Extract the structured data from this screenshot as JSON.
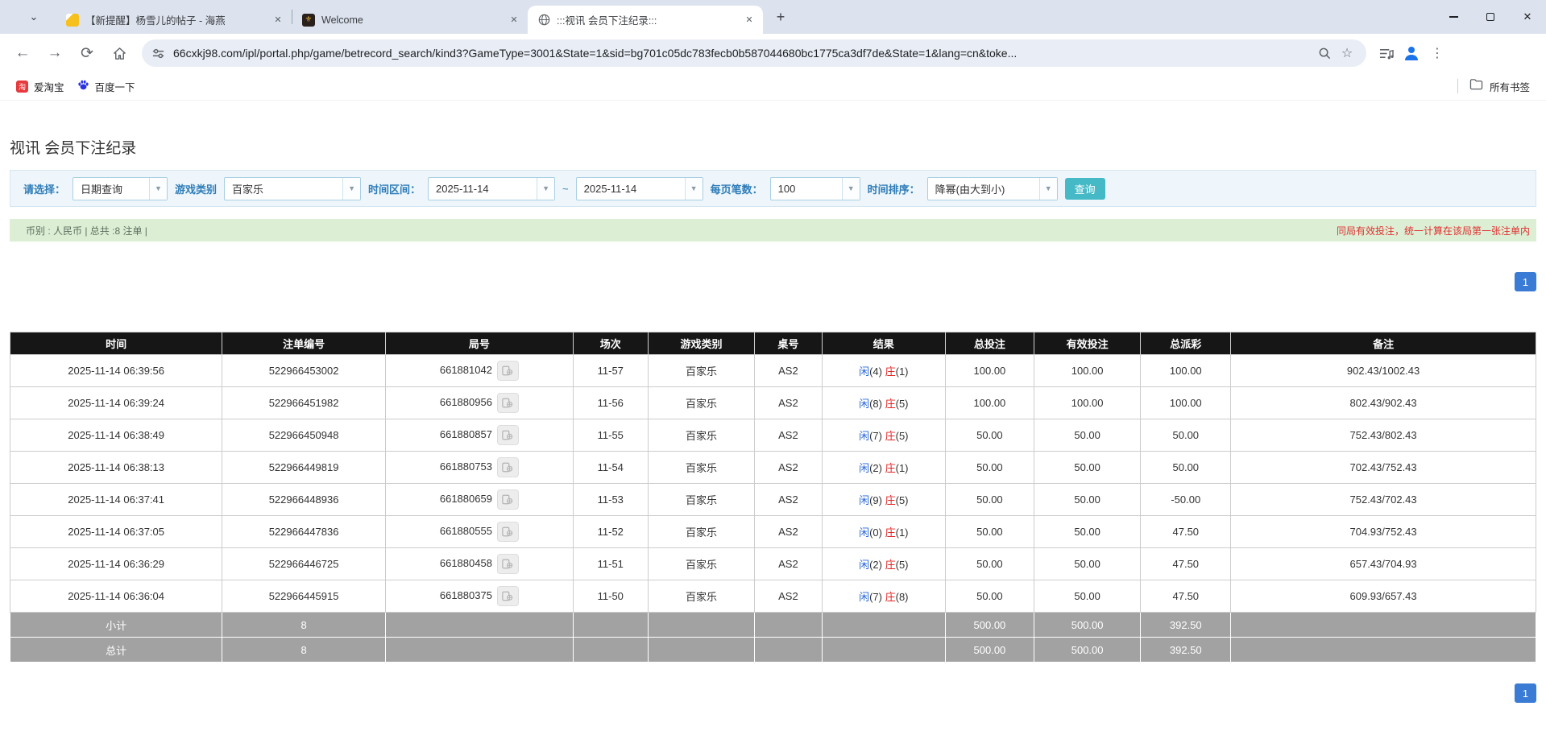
{
  "browser": {
    "tab_search_icon": "⌄",
    "tabs": [
      {
        "title": "【新提醒】杨雪儿的帖子 - 海燕",
        "close": "✕"
      },
      {
        "title": "Welcome",
        "close": "✕"
      },
      {
        "title": ":::视讯 会员下注纪录:::",
        "close": "✕"
      }
    ],
    "new_tab": "+",
    "window": {
      "close": "✕"
    },
    "url": "66cxkj98.com/ipl/portal.php/game/betrecord_search/kind3?GameType=3001&State=1&sid=bg701c05dc783fecb0b587044680bc1775ca3df7de&State=1&lang=cn&toke...",
    "bookmarks": [
      {
        "label": "爱淘宝",
        "icon_glyph": "淘"
      },
      {
        "label": "百度一下"
      }
    ],
    "all_bookmarks_label": "所有书签",
    "menu_dots": "⋮"
  },
  "page": {
    "title": "视讯 会员下注纪录",
    "filters": {
      "select_label": "请选择：",
      "select_value": "日期查询",
      "game_type_label": "游戏类别",
      "game_type_value": "百家乐",
      "date_range_label": "时间区间：",
      "date_from": "2025-11-14",
      "tilde": "~",
      "date_to": "2025-11-14",
      "per_page_label": "每页笔数：",
      "per_page_value": "100",
      "sort_label": "时间排序：",
      "sort_value": "降幂(由大到小)",
      "search_button": "查询",
      "dropdown_arrow": "▼"
    },
    "info_bar": {
      "left": "币别 : 人民币 | 总共 :8 注单 |",
      "right": "同局有效投注，统一计算在该局第一张注单内"
    },
    "pagination": {
      "page": "1"
    },
    "table": {
      "columns": [
        "时间",
        "注单编号",
        "局号",
        "场次",
        "游戏类别",
        "桌号",
        "结果",
        "总投注",
        "有效投注",
        "总派彩",
        "备注"
      ],
      "rows": [
        {
          "time": "2025-11-14 06:39:56",
          "bet_id": "522966453002",
          "round_id": "661881042",
          "session": "11-57",
          "game": "百家乐",
          "table_no": "AS2",
          "xian": "闲",
          "xian_n": "(4)",
          "zhuang": "庄",
          "zhuang_n": "(1)",
          "total_bet": "100.00",
          "valid_bet": "100.00",
          "payout": "100.00",
          "remark": "902.43/1002.43"
        },
        {
          "time": "2025-11-14 06:39:24",
          "bet_id": "522966451982",
          "round_id": "661880956",
          "session": "11-56",
          "game": "百家乐",
          "table_no": "AS2",
          "xian": "闲",
          "xian_n": "(8)",
          "zhuang": "庄",
          "zhuang_n": "(5)",
          "total_bet": "100.00",
          "valid_bet": "100.00",
          "payout": "100.00",
          "remark": "802.43/902.43"
        },
        {
          "time": "2025-11-14 06:38:49",
          "bet_id": "522966450948",
          "round_id": "661880857",
          "session": "11-55",
          "game": "百家乐",
          "table_no": "AS2",
          "xian": "闲",
          "xian_n": "(7)",
          "zhuang": "庄",
          "zhuang_n": "(5)",
          "total_bet": "50.00",
          "valid_bet": "50.00",
          "payout": "50.00",
          "remark": "752.43/802.43"
        },
        {
          "time": "2025-11-14 06:38:13",
          "bet_id": "522966449819",
          "round_id": "661880753",
          "session": "11-54",
          "game": "百家乐",
          "table_no": "AS2",
          "xian": "闲",
          "xian_n": "(2)",
          "zhuang": "庄",
          "zhuang_n": "(1)",
          "total_bet": "50.00",
          "valid_bet": "50.00",
          "payout": "50.00",
          "remark": "702.43/752.43"
        },
        {
          "time": "2025-11-14 06:37:41",
          "bet_id": "522966448936",
          "round_id": "661880659",
          "session": "11-53",
          "game": "百家乐",
          "table_no": "AS2",
          "xian": "闲",
          "xian_n": "(9)",
          "zhuang": "庄",
          "zhuang_n": "(5)",
          "total_bet": "50.00",
          "valid_bet": "50.00",
          "payout": "-50.00",
          "remark": "752.43/702.43"
        },
        {
          "time": "2025-11-14 06:37:05",
          "bet_id": "522966447836",
          "round_id": "661880555",
          "session": "11-52",
          "game": "百家乐",
          "table_no": "AS2",
          "xian": "闲",
          "xian_n": "(0)",
          "zhuang": "庄",
          "zhuang_n": "(1)",
          "total_bet": "50.00",
          "valid_bet": "50.00",
          "payout": "47.50",
          "remark": "704.93/752.43"
        },
        {
          "time": "2025-11-14 06:36:29",
          "bet_id": "522966446725",
          "round_id": "661880458",
          "session": "11-51",
          "game": "百家乐",
          "table_no": "AS2",
          "xian": "闲",
          "xian_n": "(2)",
          "zhuang": "庄",
          "zhuang_n": "(5)",
          "total_bet": "50.00",
          "valid_bet": "50.00",
          "payout": "47.50",
          "remark": "657.43/704.93"
        },
        {
          "time": "2025-11-14 06:36:04",
          "bet_id": "522966445915",
          "round_id": "661880375",
          "session": "11-50",
          "game": "百家乐",
          "table_no": "AS2",
          "xian": "闲",
          "xian_n": "(7)",
          "zhuang": "庄",
          "zhuang_n": "(8)",
          "total_bet": "50.00",
          "valid_bet": "50.00",
          "payout": "47.50",
          "remark": "609.93/657.43"
        }
      ],
      "subtotal": {
        "label": "小计",
        "count": "8",
        "total_bet": "500.00",
        "valid_bet": "500.00",
        "payout": "392.50"
      },
      "total": {
        "label": "总计",
        "count": "8",
        "total_bet": "500.00",
        "valid_bet": "500.00",
        "payout": "392.50"
      }
    }
  },
  "colors": {
    "accent_blue": "#3a7bd5",
    "link_blue": "#2667d9",
    "xian_blue": "#2667d9",
    "zhuang_red": "#e02525",
    "negative_red": "#ee2222",
    "button_teal": "#45b9c6",
    "table_header_bg": "#161616",
    "info_bar_green": "#dcefd5",
    "filter_bar_blue": "#eef6fb"
  }
}
